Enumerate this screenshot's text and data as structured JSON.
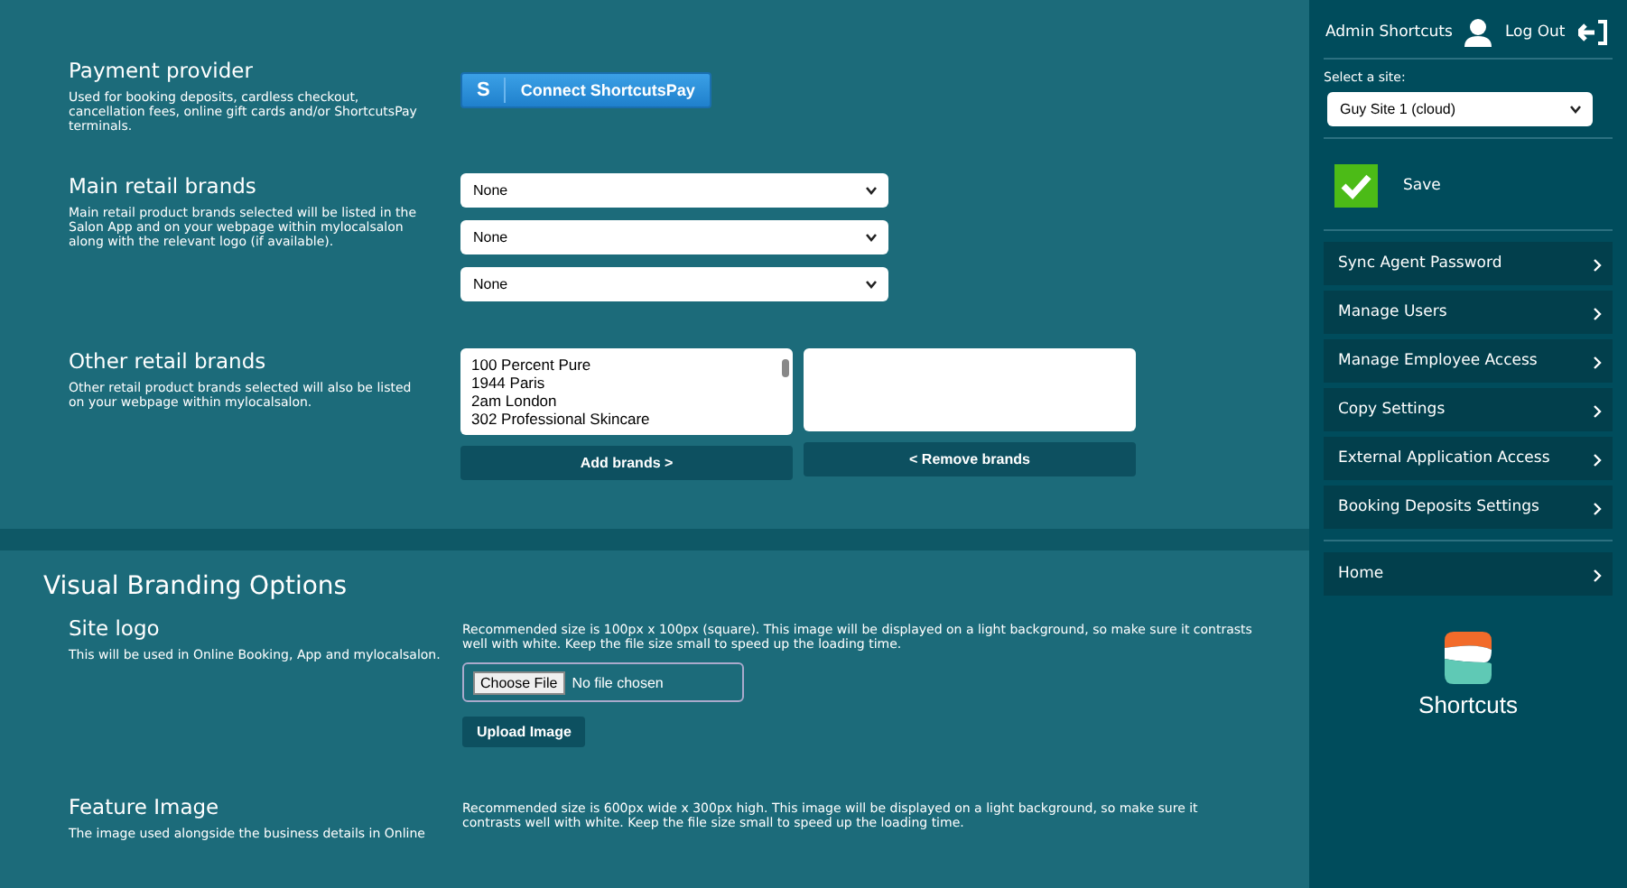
{
  "payment_provider": {
    "title": "Payment provider",
    "description": "Used for booking deposits, cardless checkout, cancellation fees, online gift cards and/or ShortcutsPay terminals.",
    "button_icon_letter": "S",
    "button_label": "Connect ShortcutsPay"
  },
  "main_brands": {
    "title": "Main retail brands",
    "description": "Main retail product brands selected will be listed in the Salon App and on your webpage within mylocalsalon along with the relevant logo (if available).",
    "selects": [
      "None",
      "None",
      "None"
    ]
  },
  "other_brands": {
    "title": "Other retail brands",
    "description": "Other retail product brands selected will also be listed on your webpage within mylocalsalon.",
    "available": [
      "100 Percent Pure",
      "1944 Paris",
      "2am London",
      "302 Professional Skincare"
    ],
    "add_button": "Add brands >",
    "remove_button": "< Remove brands"
  },
  "branding": {
    "title": "Visual Branding Options",
    "items": [
      {
        "title": "Site logo",
        "description": "This will be used in Online Booking, App and mylocalsalon.",
        "hint": "Recommended size is 100px x 100px (square). This image will be displayed on a light background, so make sure it contrasts well with white. Keep the file size small to speed up the loading time.",
        "file_button": "Choose File",
        "file_status": "No file chosen",
        "upload_button": "Upload Image"
      },
      {
        "title": "Feature Image",
        "description": "The image used alongside the business details in Online",
        "hint": "Recommended size is 600px wide x 300px high. This image will be displayed on a light background, so make sure it contrasts well with white. Keep the file size small to speed up the loading time."
      }
    ]
  },
  "sidebar": {
    "admin_label": "Admin Shortcuts",
    "logout_label": "Log Out",
    "site_label": "Select a site:",
    "site_value": "Guy Site 1 (cloud)",
    "save_label": "Save",
    "menu": [
      "Sync Agent Password",
      "Manage Users",
      "Manage Employee Access",
      "Copy Settings",
      "External Application Access",
      "Booking Deposits Settings"
    ],
    "home": "Home",
    "logo_text": "Shortcuts"
  }
}
